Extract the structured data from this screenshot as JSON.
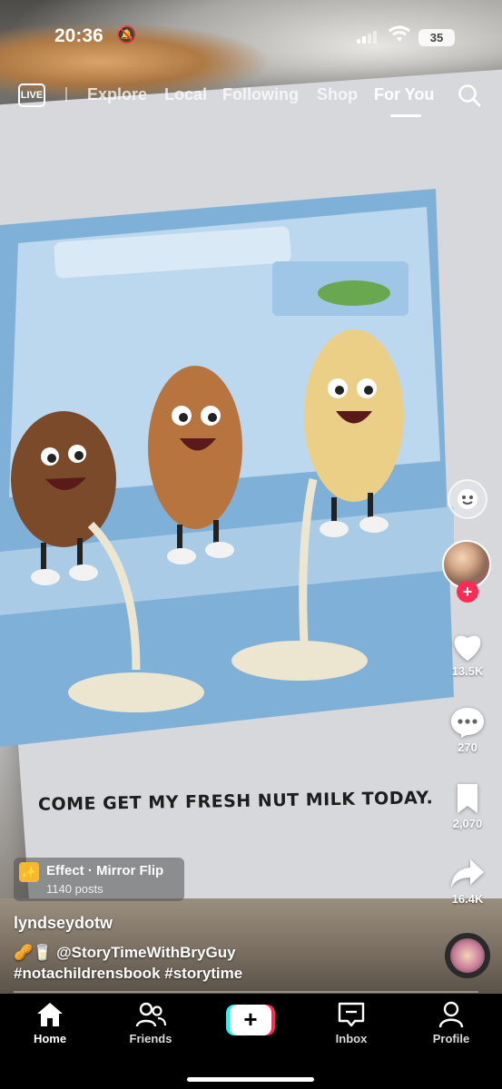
{
  "status_bar": {
    "time": "20:36",
    "battery": "35"
  },
  "top_nav": {
    "live_label": "LIVE",
    "tabs": [
      {
        "label": "Explore",
        "active": false
      },
      {
        "label": "Local",
        "active": false
      },
      {
        "label": "Following",
        "active": false
      },
      {
        "label": "Shop",
        "active": false
      },
      {
        "label": "For You",
        "active": true
      }
    ]
  },
  "video": {
    "page_caption": "COME GET MY FRESH NUT MILK TODAY."
  },
  "actions": {
    "likes": "13.5K",
    "comments": "270",
    "saves": "2,070",
    "shares": "16.4K",
    "follow_icon": "plus-icon"
  },
  "effect": {
    "name": "Effect · Mirror Flip",
    "posts": "1140 posts"
  },
  "post": {
    "username": "lyndseydotw",
    "mention": "@StoryTimeWithBryGuy",
    "hashtags": "#notachildrensbook #storytime"
  },
  "tabbar": {
    "items": [
      {
        "label": "Home",
        "icon": "home-icon",
        "active": true
      },
      {
        "label": "Friends",
        "icon": "friends-icon",
        "active": false
      },
      {
        "label": "Inbox",
        "icon": "inbox-icon",
        "active": false
      },
      {
        "label": "Profile",
        "icon": "profile-icon",
        "active": false
      }
    ]
  },
  "colors": {
    "accent_red": "#fe2c55",
    "accent_cyan": "#25f4ee",
    "tabbar_bg": "#000000"
  }
}
